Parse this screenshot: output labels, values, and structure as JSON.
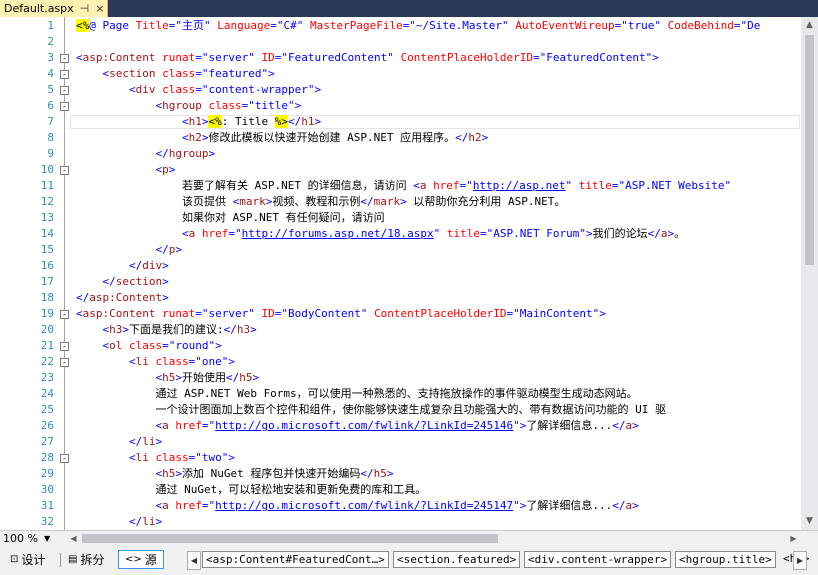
{
  "tab": {
    "title": "Default.aspx",
    "pin": "⊣",
    "close": "×"
  },
  "lines": [
    {
      "n": "1",
      "segs": [
        [
          "d",
          "<%"
        ],
        [
          "b",
          "@ Page "
        ],
        [
          "a",
          "Title"
        ],
        [
          "b",
          "=\"主页\" "
        ],
        [
          "a",
          "Language"
        ],
        [
          "b",
          "=\"C#\" "
        ],
        [
          "a",
          "MasterPageFile"
        ],
        [
          "b",
          "=\"~/Site.Master\" "
        ],
        [
          "a",
          "AutoEventWireup"
        ],
        [
          "b",
          "=\"true\" "
        ],
        [
          "a",
          "CodeBehind"
        ],
        [
          "b",
          "=\"De"
        ]
      ]
    },
    {
      "n": "2",
      "segs": []
    },
    {
      "n": "3",
      "segs": [
        [
          "b",
          "<"
        ],
        [
          "t",
          "asp:Content"
        ],
        [
          "b",
          " "
        ],
        [
          "a",
          "runat"
        ],
        [
          "b",
          "=\"server\" "
        ],
        [
          "a",
          "ID"
        ],
        [
          "b",
          "=\"FeaturedContent\" "
        ],
        [
          "a",
          "ContentPlaceHolderID"
        ],
        [
          "b",
          "=\"FeaturedContent\">"
        ]
      ]
    },
    {
      "n": "4",
      "segs": [
        [
          "n",
          "    "
        ],
        [
          "b",
          "<"
        ],
        [
          "t",
          "section"
        ],
        [
          "b",
          " "
        ],
        [
          "a",
          "class"
        ],
        [
          "b",
          "=\"featured\">"
        ]
      ]
    },
    {
      "n": "5",
      "segs": [
        [
          "n",
          "        "
        ],
        [
          "b",
          "<"
        ],
        [
          "t",
          "div"
        ],
        [
          "b",
          " "
        ],
        [
          "a",
          "class"
        ],
        [
          "b",
          "=\"content-wrapper\">"
        ]
      ]
    },
    {
      "n": "6",
      "segs": [
        [
          "n",
          "            "
        ],
        [
          "b",
          "<"
        ],
        [
          "t",
          "hgroup"
        ],
        [
          "b",
          " "
        ],
        [
          "a",
          "class"
        ],
        [
          "b",
          "=\"title\">"
        ]
      ]
    },
    {
      "n": "7",
      "segs": [
        [
          "n",
          "                "
        ],
        [
          "b",
          "<"
        ],
        [
          "t",
          "h1"
        ],
        [
          "b",
          ">"
        ],
        [
          "d",
          "<%"
        ],
        [
          "n",
          ": Title "
        ],
        [
          "d",
          "%>"
        ],
        [
          "b",
          "</"
        ],
        [
          "t",
          "h1"
        ],
        [
          "b",
          ">"
        ]
      ]
    },
    {
      "n": "8",
      "segs": [
        [
          "n",
          "                "
        ],
        [
          "b",
          "<"
        ],
        [
          "t",
          "h2"
        ],
        [
          "b",
          ">"
        ],
        [
          "n",
          "修改此模板以快速开始创建 ASP.NET 应用程序。"
        ],
        [
          "b",
          "</"
        ],
        [
          "t",
          "h2"
        ],
        [
          "b",
          ">"
        ]
      ]
    },
    {
      "n": "9",
      "segs": [
        [
          "n",
          "            "
        ],
        [
          "b",
          "</"
        ],
        [
          "t",
          "hgroup"
        ],
        [
          "b",
          ">"
        ]
      ]
    },
    {
      "n": "10",
      "segs": [
        [
          "n",
          "            "
        ],
        [
          "b",
          "<"
        ],
        [
          "t",
          "p"
        ],
        [
          "b",
          ">"
        ]
      ]
    },
    {
      "n": "11",
      "segs": [
        [
          "n",
          "                若要了解有关 ASP.NET 的详细信息，请访问 "
        ],
        [
          "b",
          "<"
        ],
        [
          "t",
          "a"
        ],
        [
          "b",
          " "
        ],
        [
          "a",
          "href"
        ],
        [
          "b",
          "=\""
        ],
        [
          "u",
          "http://asp.net"
        ],
        [
          "b",
          "\" "
        ],
        [
          "a",
          "title"
        ],
        [
          "b",
          "=\"ASP.NET Website\""
        ]
      ]
    },
    {
      "n": "12",
      "segs": [
        [
          "n",
          "                该页提供 "
        ],
        [
          "b",
          "<"
        ],
        [
          "t",
          "mark"
        ],
        [
          "b",
          ">"
        ],
        [
          "n",
          "视频、教程和示例"
        ],
        [
          "b",
          "</"
        ],
        [
          "t",
          "mark"
        ],
        [
          "b",
          ">"
        ],
        [
          "n",
          " 以帮助你充分利用 ASP.NET。"
        ]
      ]
    },
    {
      "n": "13",
      "segs": [
        [
          "n",
          "                如果你对 ASP.NET 有任何疑问，请访问"
        ]
      ]
    },
    {
      "n": "14",
      "segs": [
        [
          "n",
          "                "
        ],
        [
          "b",
          "<"
        ],
        [
          "t",
          "a"
        ],
        [
          "b",
          " "
        ],
        [
          "a",
          "href"
        ],
        [
          "b",
          "=\""
        ],
        [
          "u",
          "http://forums.asp.net/18.aspx"
        ],
        [
          "b",
          "\" "
        ],
        [
          "a",
          "title"
        ],
        [
          "b",
          "=\"ASP.NET Forum\">"
        ],
        [
          "n",
          "我们的论坛"
        ],
        [
          "b",
          "</"
        ],
        [
          "t",
          "a"
        ],
        [
          "b",
          ">"
        ],
        [
          "n",
          "。"
        ]
      ]
    },
    {
      "n": "15",
      "segs": [
        [
          "n",
          "            "
        ],
        [
          "b",
          "</"
        ],
        [
          "t",
          "p"
        ],
        [
          "b",
          ">"
        ]
      ]
    },
    {
      "n": "16",
      "segs": [
        [
          "n",
          "        "
        ],
        [
          "b",
          "</"
        ],
        [
          "t",
          "div"
        ],
        [
          "b",
          ">"
        ]
      ]
    },
    {
      "n": "17",
      "segs": [
        [
          "n",
          "    "
        ],
        [
          "b",
          "</"
        ],
        [
          "t",
          "section"
        ],
        [
          "b",
          ">"
        ]
      ]
    },
    {
      "n": "18",
      "segs": [
        [
          "b",
          "</"
        ],
        [
          "t",
          "asp:Content"
        ],
        [
          "b",
          ">"
        ]
      ]
    },
    {
      "n": "19",
      "segs": [
        [
          "b",
          "<"
        ],
        [
          "t",
          "asp:Content"
        ],
        [
          "b",
          " "
        ],
        [
          "a",
          "runat"
        ],
        [
          "b",
          "=\"server\" "
        ],
        [
          "a",
          "ID"
        ],
        [
          "b",
          "=\"BodyContent\" "
        ],
        [
          "a",
          "ContentPlaceHolderID"
        ],
        [
          "b",
          "=\"MainContent\">"
        ]
      ]
    },
    {
      "n": "20",
      "segs": [
        [
          "n",
          "    "
        ],
        [
          "b",
          "<"
        ],
        [
          "t",
          "h3"
        ],
        [
          "b",
          ">"
        ],
        [
          "n",
          "下面是我们的建议:"
        ],
        [
          "b",
          "</"
        ],
        [
          "t",
          "h3"
        ],
        [
          "b",
          ">"
        ]
      ]
    },
    {
      "n": "21",
      "segs": [
        [
          "n",
          "    "
        ],
        [
          "b",
          "<"
        ],
        [
          "t",
          "ol"
        ],
        [
          "b",
          " "
        ],
        [
          "a",
          "class"
        ],
        [
          "b",
          "=\"round\">"
        ]
      ]
    },
    {
      "n": "22",
      "segs": [
        [
          "n",
          "        "
        ],
        [
          "b",
          "<"
        ],
        [
          "t",
          "li"
        ],
        [
          "b",
          " "
        ],
        [
          "a",
          "class"
        ],
        [
          "b",
          "=\"one\">"
        ]
      ]
    },
    {
      "n": "23",
      "segs": [
        [
          "n",
          "            "
        ],
        [
          "b",
          "<"
        ],
        [
          "t",
          "h5"
        ],
        [
          "b",
          ">"
        ],
        [
          "n",
          "开始使用"
        ],
        [
          "b",
          "</"
        ],
        [
          "t",
          "h5"
        ],
        [
          "b",
          ">"
        ]
      ]
    },
    {
      "n": "24",
      "segs": [
        [
          "n",
          "            通过 ASP.NET Web Forms，可以使用一种熟悉的、支持拖放操作的事件驱动模型生成动态网站。"
        ]
      ]
    },
    {
      "n": "25",
      "segs": [
        [
          "n",
          "            一个设计图面加上数百个控件和组件，使你能够快速生成复杂且功能强大的、带有数据访问功能的 UI 驱"
        ]
      ]
    },
    {
      "n": "26",
      "segs": [
        [
          "n",
          "            "
        ],
        [
          "b",
          "<"
        ],
        [
          "t",
          "a"
        ],
        [
          "b",
          " "
        ],
        [
          "a",
          "href"
        ],
        [
          "b",
          "=\""
        ],
        [
          "u",
          "http://go.microsoft.com/fwlink/?LinkId=245146"
        ],
        [
          "b",
          "\">"
        ],
        [
          "n",
          "了解详细信息..."
        ],
        [
          "b",
          "</"
        ],
        [
          "t",
          "a"
        ],
        [
          "b",
          ">"
        ]
      ]
    },
    {
      "n": "27",
      "segs": [
        [
          "n",
          "        "
        ],
        [
          "b",
          "</"
        ],
        [
          "t",
          "li"
        ],
        [
          "b",
          ">"
        ]
      ]
    },
    {
      "n": "28",
      "segs": [
        [
          "n",
          "        "
        ],
        [
          "b",
          "<"
        ],
        [
          "t",
          "li"
        ],
        [
          "b",
          " "
        ],
        [
          "a",
          "class"
        ],
        [
          "b",
          "=\"two\">"
        ]
      ]
    },
    {
      "n": "29",
      "segs": [
        [
          "n",
          "            "
        ],
        [
          "b",
          "<"
        ],
        [
          "t",
          "h5"
        ],
        [
          "b",
          ">"
        ],
        [
          "n",
          "添加 NuGet 程序包并快速开始编码"
        ],
        [
          "b",
          "</"
        ],
        [
          "t",
          "h5"
        ],
        [
          "b",
          ">"
        ]
      ]
    },
    {
      "n": "30",
      "segs": [
        [
          "n",
          "            通过 NuGet，可以轻松地安装和更新免费的库和工具。"
        ]
      ]
    },
    {
      "n": "31",
      "segs": [
        [
          "n",
          "            "
        ],
        [
          "b",
          "<"
        ],
        [
          "t",
          "a"
        ],
        [
          "b",
          " "
        ],
        [
          "a",
          "href"
        ],
        [
          "b",
          "=\""
        ],
        [
          "u",
          "http://go.microsoft.com/fwlink/?LinkId=245147"
        ],
        [
          "b",
          "\">"
        ],
        [
          "n",
          "了解详细信息..."
        ],
        [
          "b",
          "</"
        ],
        [
          "t",
          "a"
        ],
        [
          "b",
          ">"
        ]
      ]
    },
    {
      "n": "32",
      "segs": [
        [
          "n",
          "        "
        ],
        [
          "b",
          "</"
        ],
        [
          "t",
          "li"
        ],
        [
          "b",
          ">"
        ]
      ]
    }
  ],
  "zoom": "100 %",
  "views": {
    "design": "设计",
    "split": "拆分",
    "source": "源"
  },
  "breadcrumbs": [
    "<asp:Content#FeaturedCont…>",
    "<section.featured>",
    "<div.content-wrapper>",
    "<hgroup.title>",
    "<h1>"
  ]
}
